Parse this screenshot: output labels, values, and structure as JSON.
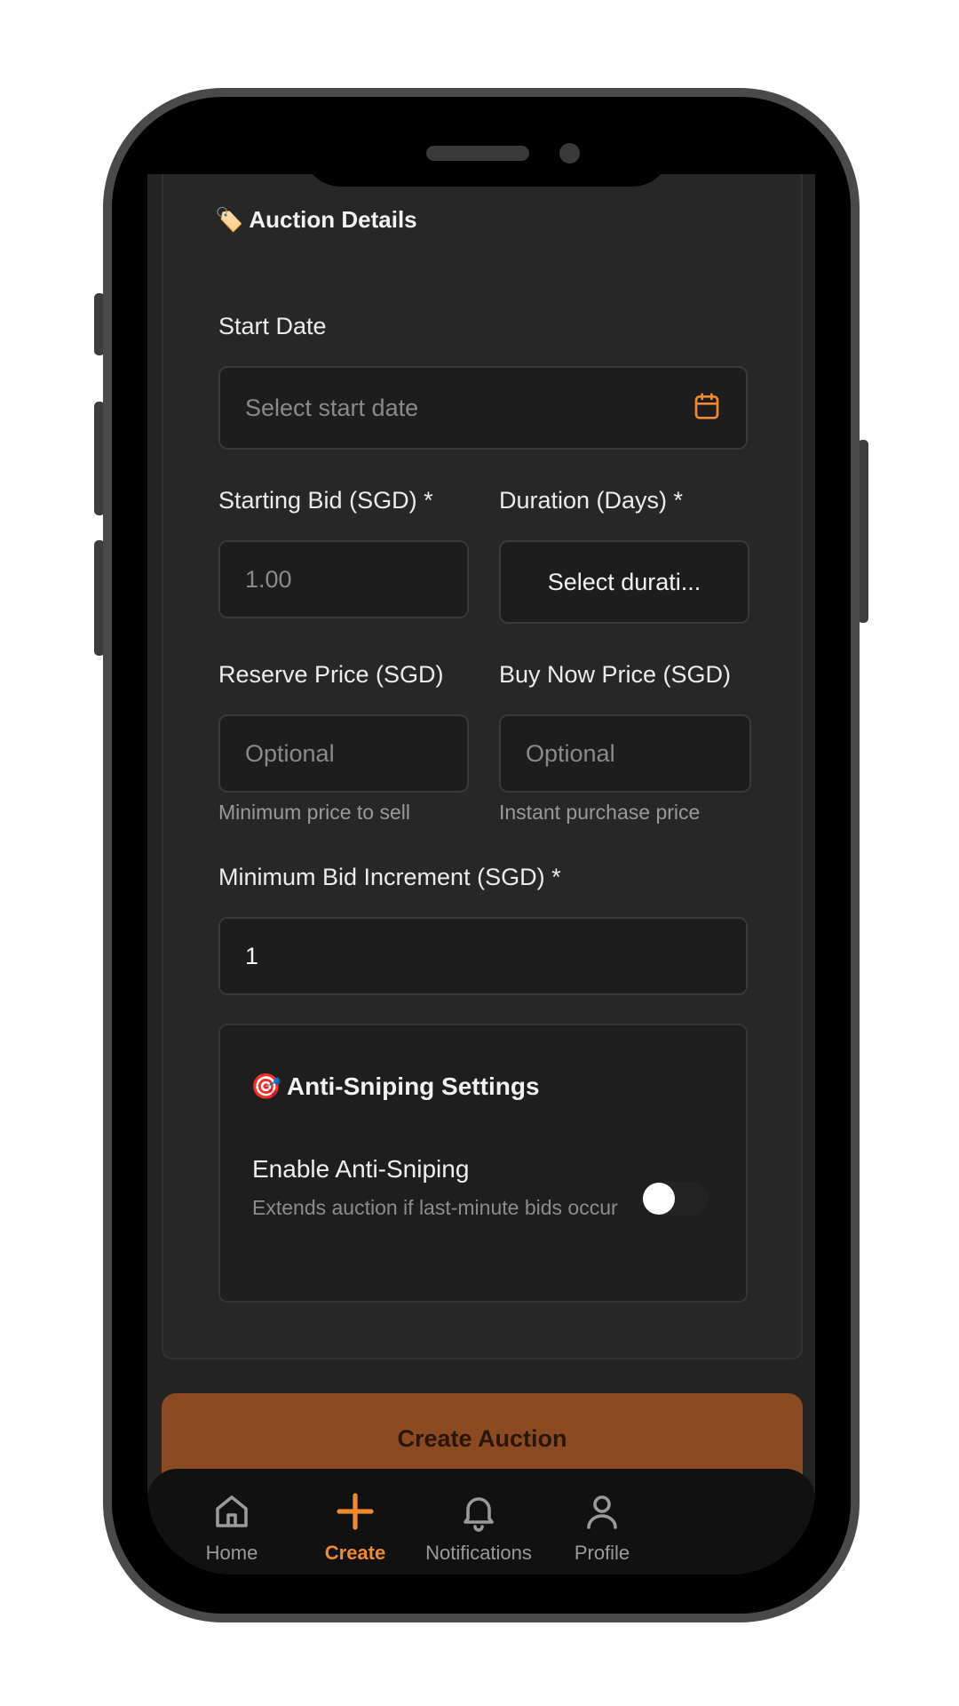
{
  "section": {
    "emoji": "🏷️",
    "title": "Auction Details"
  },
  "start_date": {
    "label": "Start Date",
    "placeholder": "Select start date",
    "icon": "calendar-icon"
  },
  "starting_bid": {
    "label": "Starting Bid (SGD) *",
    "placeholder": "1.00"
  },
  "duration": {
    "label": "Duration (Days) *",
    "selected": "Select durati..."
  },
  "reserve_price": {
    "label": "Reserve Price (SGD)",
    "placeholder": "Optional",
    "hint": "Minimum price to sell"
  },
  "buy_now_price": {
    "label": "Buy Now Price (SGD)",
    "placeholder": "Optional",
    "hint": "Instant purchase price"
  },
  "min_increment": {
    "label": "Minimum Bid Increment (SGD) *",
    "value": "1"
  },
  "anti_sniping": {
    "emoji": "🎯",
    "title": "Anti-Sniping Settings",
    "toggle_label": "Enable Anti-Sniping",
    "toggle_description": "Extends auction if last-minute bids occur",
    "enabled": false
  },
  "create_button": {
    "label": "Create Auction"
  },
  "nav": {
    "items": [
      {
        "label": "Home",
        "icon": "home-icon",
        "active": false
      },
      {
        "label": "Create",
        "icon": "plus-icon",
        "active": true
      },
      {
        "label": "Notifications",
        "icon": "bell-icon",
        "active": false
      },
      {
        "label": "Profile",
        "icon": "user-icon",
        "active": false
      }
    ]
  },
  "colors": {
    "accent": "#f08a2e",
    "button_bg": "#8b4a22",
    "background": "#232323"
  }
}
